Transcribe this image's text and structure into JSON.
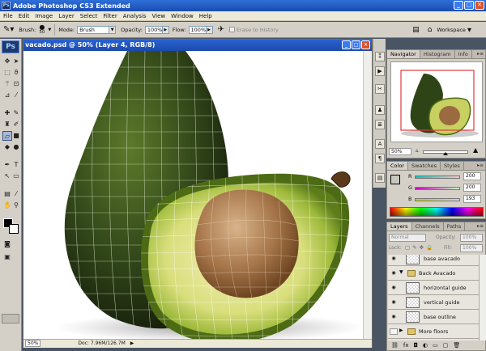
{
  "app": {
    "title": "Adobe Photoshop CS3 Extended",
    "logo": "Ps",
    "title_icon": "ps-icon"
  },
  "window_controls": {
    "minimize": "_",
    "maximize": "□",
    "close": "✕"
  },
  "menu": [
    "File",
    "Edit",
    "Image",
    "Layer",
    "Select",
    "Filter",
    "Analysis",
    "View",
    "Window",
    "Help"
  ],
  "options": {
    "brush_label": "Brush:",
    "brush_size": "50",
    "mode_label": "Mode:",
    "mode_value": "Brush",
    "opacity_label": "Opacity:",
    "opacity_value": "100%",
    "flow_label": "Flow:",
    "flow_value": "100%",
    "history_label": "Erase to History",
    "workspace_label": "Workspace ▼"
  },
  "document": {
    "title": "vacado.psd @ 50% (Layer 4, RGB/8)",
    "status_zoom": "50%",
    "status_doc": "Doc: 7.96M/126.7M"
  },
  "navigator": {
    "tabs": [
      "Navigator",
      "Histogram",
      "Info"
    ],
    "zoom": "50%",
    "zoom_level": 0.5
  },
  "color": {
    "tabs": [
      "Color",
      "Swatches",
      "Styles"
    ],
    "r_label": "R",
    "r_value": "200",
    "g_label": "G",
    "g_value": "200",
    "b_label": "B",
    "b_value": "193",
    "colors": {
      "fg": "#c8c8c1"
    }
  },
  "layers": {
    "tabs": [
      "Layers",
      "Channels",
      "Paths"
    ],
    "blend": "Normal",
    "opacity_label": "Opacity:",
    "opacity_value": "100%",
    "lock_label": "Lock:",
    "fill_label": "Fill:",
    "fill_value": "100%",
    "rows": [
      {
        "name": "base avacado"
      },
      {
        "name": "Back Avacado"
      },
      {
        "name": "horizontal guide"
      },
      {
        "name": "vertical guide"
      },
      {
        "name": "base outline"
      },
      {
        "name": "More floors"
      }
    ],
    "bottom_icons": [
      "link-icon",
      "fx-icon",
      "mask-icon",
      "adjustment-icon",
      "folder-icon",
      "new-layer-icon",
      "trash-icon"
    ]
  },
  "toolbox": {
    "tools": [
      "move-icon",
      "marquee-icon",
      "lasso-icon",
      "magic-wand-icon",
      "crop-icon",
      "slice-icon",
      "healing-icon",
      "brush-icon",
      "stamp-icon",
      "history-brush-icon",
      "eraser-icon",
      "gradient-icon",
      "blur-icon",
      "dodge-icon",
      "pen-icon",
      "type-icon",
      "path-select-icon",
      "shape-icon",
      "notes-icon",
      "eyedropper-icon",
      "hand-icon",
      "zoom-icon"
    ]
  }
}
